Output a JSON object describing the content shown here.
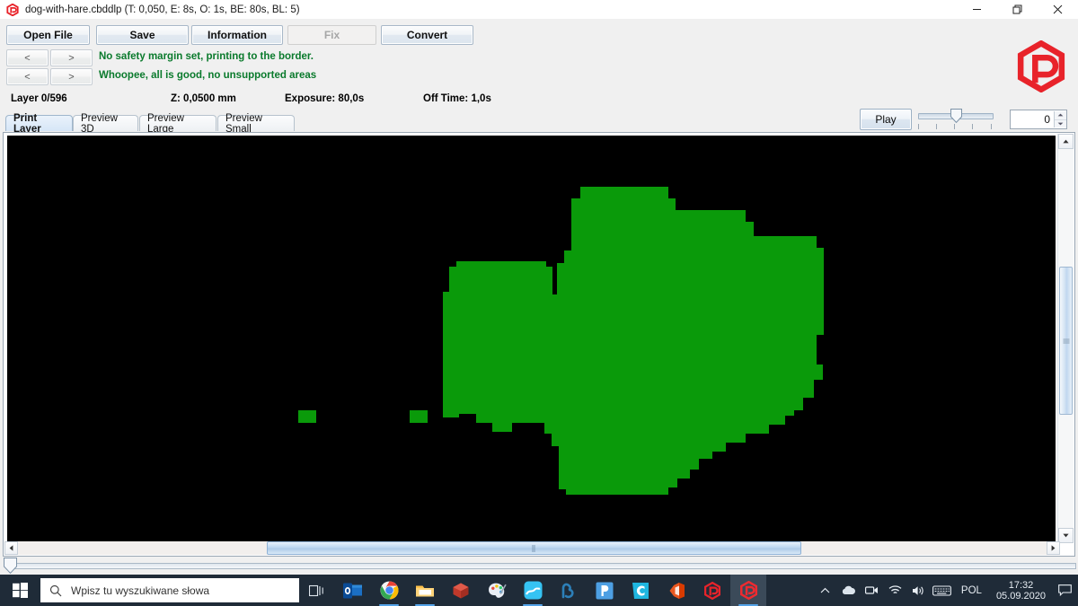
{
  "window": {
    "title": "dog-with-hare.cbddlp (T: 0,050, E: 8s, O: 1s, BE: 80s, BL: 5)",
    "app_icon": "uvtools-hex-p-icon",
    "minimize": "minimize-icon",
    "maximize": "restore-icon",
    "close": "close-icon"
  },
  "toolbar": {
    "open_file": "Open File",
    "save": "Save",
    "information": "Information",
    "fix": "Fix",
    "convert": "Convert",
    "nav_prev": "<",
    "nav_next": ">",
    "messages": {
      "safety": "No safety margin set, printing to the border.",
      "supports": "Whoopee, all is good, no unsupported areas"
    }
  },
  "status": {
    "layer": "Layer 0/596",
    "z": "Z: 0,0500 mm",
    "exposure": "Exposure: 80,0s",
    "off_time": "Off Time: 1,0s"
  },
  "playback": {
    "play_label": "Play",
    "slider_value": 0,
    "spinner_value": "0",
    "spin_up": "spin-up-icon",
    "spin_down": "spin-down-icon"
  },
  "tabs": [
    {
      "label": "Print Layer",
      "active": true
    },
    {
      "label": "Preview 3D",
      "active": false
    },
    {
      "label": "Preview Large",
      "active": false
    },
    {
      "label": "Preview Small",
      "active": false
    }
  ],
  "viewer": {
    "background_color": "#000000",
    "layer_color": "#0a9a0a",
    "scroll_up": "scroll-up-arrow-icon",
    "scroll_down": "scroll-down-arrow-icon",
    "scroll_left": "scroll-left-arrow-icon",
    "scroll_right": "scroll-right-arrow-icon"
  },
  "colors": {
    "message_green": "#0a7a2c",
    "logo_red": "#e8232a",
    "taskbar": "#1f2b38",
    "accent_blue": "#54a3e8"
  },
  "taskbar": {
    "start": "windows-start-icon",
    "search_placeholder": "Wpisz tu wyszukiwane słowa",
    "search_icon": "search-icon",
    "items": [
      {
        "name": "task-view-icon",
        "label": ""
      },
      {
        "name": "outlook-icon",
        "label": "o"
      },
      {
        "name": "chrome-icon",
        "label": ""
      },
      {
        "name": "file-explorer-icon",
        "label": ""
      },
      {
        "name": "3d-viewer-icon",
        "label": ""
      },
      {
        "name": "paint-3d-icon",
        "label": ""
      },
      {
        "name": "photos-icon",
        "label": ""
      },
      {
        "name": "meshmixer-icon",
        "label": ""
      },
      {
        "name": "prusaslicer-icon",
        "label": "P"
      },
      {
        "name": "chitubox-icon",
        "label": "C"
      },
      {
        "name": "office-icon",
        "label": ""
      },
      {
        "name": "uvtools-icon",
        "label": ""
      },
      {
        "name": "uvtools-active-icon",
        "label": ""
      }
    ],
    "tray": {
      "chevron": "chevron-up-icon",
      "onedrive": "onedrive-cloud-icon",
      "device": "device-icon",
      "wifi": "wifi-icon",
      "volume": "volume-icon",
      "keyboard": "keyboard-icon",
      "language": "POL",
      "time": "17:32",
      "date": "05.09.2020",
      "notifications": "notification-icon"
    }
  }
}
